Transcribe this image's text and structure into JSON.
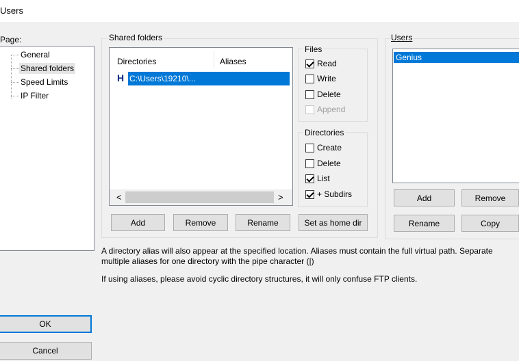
{
  "window": {
    "title": "Users"
  },
  "page_panel": {
    "label": "Page:",
    "items": [
      "General",
      "Shared folders",
      "Speed Limits",
      "IP Filter"
    ],
    "selected": "Shared folders"
  },
  "shared_folders": {
    "group_label": "Shared folders",
    "columns": [
      "Directories",
      "Aliases"
    ],
    "rows": [
      {
        "marker": "H",
        "directory": "C:\\Users\\19210\\...",
        "alias": ""
      }
    ],
    "scroll_left": "<",
    "scroll_right": ">",
    "buttons": {
      "add": "Add",
      "remove": "Remove",
      "rename": "Rename",
      "set_home": "Set as home dir"
    }
  },
  "files": {
    "group_label": "Files",
    "read": {
      "label": "Read",
      "checked": true
    },
    "write": {
      "label": "Write",
      "checked": false
    },
    "delete": {
      "label": "Delete",
      "checked": false
    },
    "append": {
      "label": "Append",
      "checked": false,
      "disabled": true
    }
  },
  "directories": {
    "group_label": "Directories",
    "create": {
      "label": "Create",
      "checked": false
    },
    "delete": {
      "label": "Delete",
      "checked": false
    },
    "list": {
      "label": "List",
      "checked": true
    },
    "subdirs": {
      "label": "+ Subdirs",
      "checked": true
    }
  },
  "users": {
    "group_label": "Users",
    "items": [
      "Genius"
    ],
    "buttons": {
      "add": "Add",
      "remove": "Remove",
      "rename": "Rename",
      "copy": "Copy"
    }
  },
  "info": {
    "text1": "A directory alias will also appear at the specified location. Aliases must contain the full virtual path. Separate multiple aliases for one directory with the pipe character (|)",
    "text2": "If using aliases, please avoid cyclic directory structures, it will only confuse FTP clients."
  },
  "dialog_buttons": {
    "ok": "OK",
    "cancel": "Cancel"
  },
  "colors": {
    "selection": "#0078d7",
    "home_marker": "#0a2a8a"
  }
}
